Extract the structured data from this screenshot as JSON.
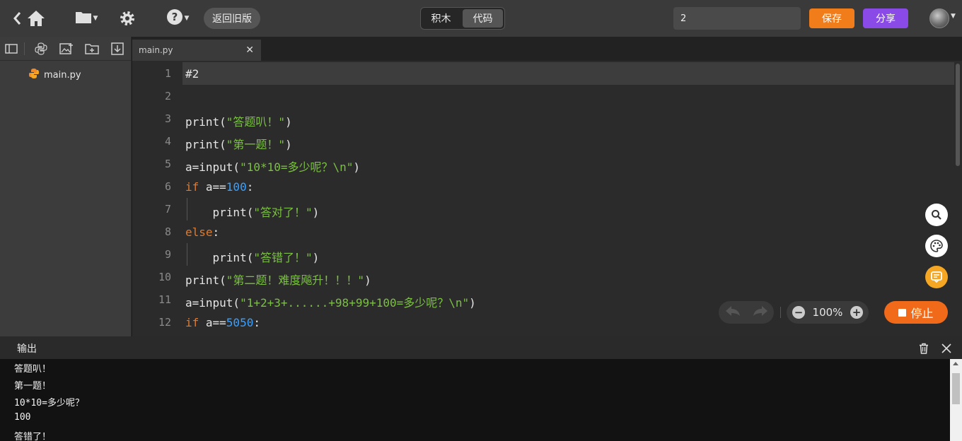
{
  "topbar": {
    "icons": [
      "back-icon",
      "home-icon",
      "folder-icon",
      "gear-icon",
      "help-icon"
    ],
    "old_version_label": "返回旧版",
    "mode_tabs": [
      {
        "label": "积木",
        "active": false
      },
      {
        "label": "代码",
        "active": true
      }
    ],
    "project_name": "2",
    "save_label": "保存",
    "share_label": "分享"
  },
  "file_panel": {
    "tools": [
      "toggle-panel-icon",
      "python-icon",
      "image-add-icon",
      "folder-add-icon",
      "download-icon"
    ],
    "files": [
      {
        "name": "main.py",
        "icon": "python-icon"
      }
    ]
  },
  "editor": {
    "tab": {
      "filename": "main.py"
    },
    "lines": [
      {
        "n": "1",
        "code": "#2"
      },
      {
        "n": "2",
        "code": ""
      },
      {
        "n": "3",
        "code": "print(\"答题叭！\")"
      },
      {
        "n": "4",
        "code": "print(\"第一题！\")"
      },
      {
        "n": "5",
        "code": "a=input(\"10*10=多少呢？\\n\")"
      },
      {
        "n": "6",
        "code": "if a==100:"
      },
      {
        "n": "7",
        "code": "    print(\"答对了！\")"
      },
      {
        "n": "8",
        "code": "else:"
      },
      {
        "n": "9",
        "code": "    print(\"答错了！\")"
      },
      {
        "n": "10",
        "code": "print(\"第二题！难度飚升！！！\")"
      },
      {
        "n": "11",
        "code": "a=input(\"1+2+3+......+98+99+100=多少呢？\\n\")"
      },
      {
        "n": "12",
        "code": "if a==5050:"
      }
    ],
    "zoom": "100%",
    "stop_label": "停止",
    "side_tools": [
      "search-icon",
      "palette-icon",
      "feedback-icon"
    ]
  },
  "output": {
    "title": "输出",
    "lines": [
      "答题叭！",
      "第一题！",
      "10*10=多少呢？",
      "100",
      "答错了！"
    ]
  },
  "colors": {
    "keyword": "#e07a2c",
    "string": "#7bc043",
    "number": "#3aa0ff",
    "comment": "#6f6f6f",
    "save": "#f07c1a",
    "share": "#8a4ae8",
    "stop": "#f06a1a"
  }
}
